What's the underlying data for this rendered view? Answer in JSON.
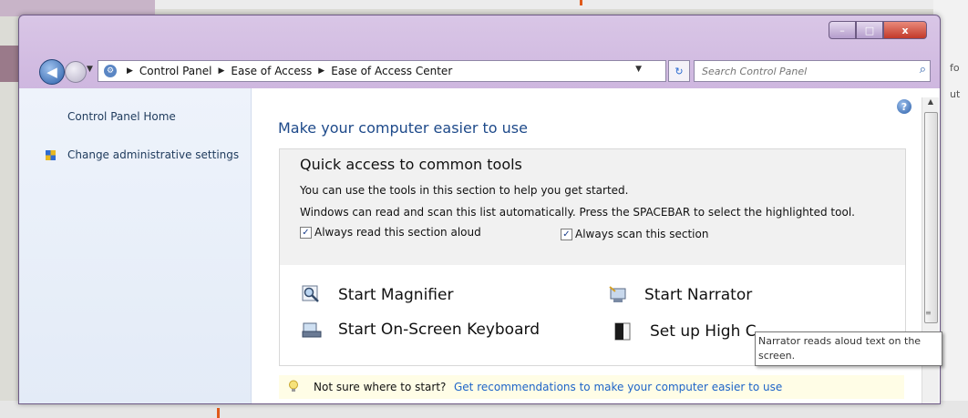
{
  "background": {
    "right_text_1": "fo",
    "right_text_2": "ut"
  },
  "window": {
    "caption_buttons": {
      "minimize": "–",
      "maximize": "□",
      "close": "x"
    }
  },
  "address_bar": {
    "icon": "control-panel-icon",
    "breadcrumbs": [
      "Control Panel",
      "Ease of Access",
      "Ease of Access Center"
    ],
    "search_placeholder": "Search Control Panel"
  },
  "left_pane": {
    "home_link": "Control Panel Home",
    "admin_link": "Change administrative settings"
  },
  "main": {
    "title": "Make your computer easier to use",
    "quick_access": {
      "heading": "Quick access to common tools",
      "line1": "You can use the tools in this section to help you get started.",
      "line2": "Windows can read and scan this list automatically.  Press the SPACEBAR to select the highlighted tool.",
      "checkbox_read_aloud": {
        "label": "Always read this section aloud",
        "checked": true
      },
      "checkbox_scan": {
        "label": "Always scan this section",
        "checked": true
      }
    },
    "tools": {
      "magnifier": "Start Magnifier",
      "narrator": "Start Narrator",
      "keyboard": "Start On-Screen Keyboard",
      "high_contrast": "Set up High C"
    },
    "hint": {
      "text": "Not sure where to start?",
      "link": "Get recommendations to make your computer easier to use"
    }
  },
  "tooltip": {
    "text": "Narrator reads aloud text on the screen."
  }
}
